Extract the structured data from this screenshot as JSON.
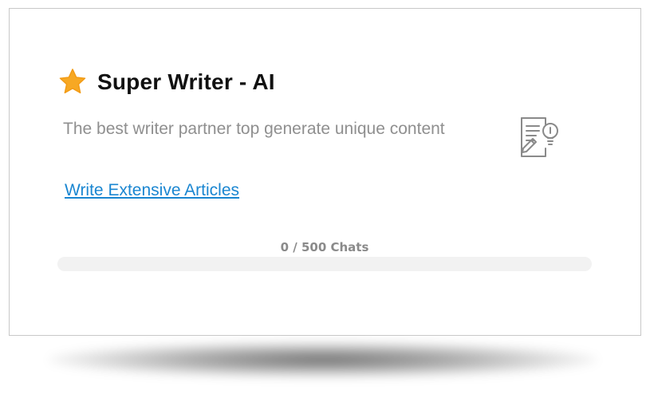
{
  "card": {
    "title": "Super Writer - AI",
    "description": "The best writer partner top generate unique content",
    "link_label": "Write Extensive Articles",
    "title_icon": "star-icon",
    "feature_icon": "document-lightbulb-icon"
  },
  "usage": {
    "label": "0 / 500 Chats",
    "used": 0,
    "limit": 500,
    "fraction": 0
  },
  "colors": {
    "star": "#f7a823",
    "link": "#1a86d1",
    "description": "#8f8f8f",
    "track": "#f2f2f2"
  }
}
